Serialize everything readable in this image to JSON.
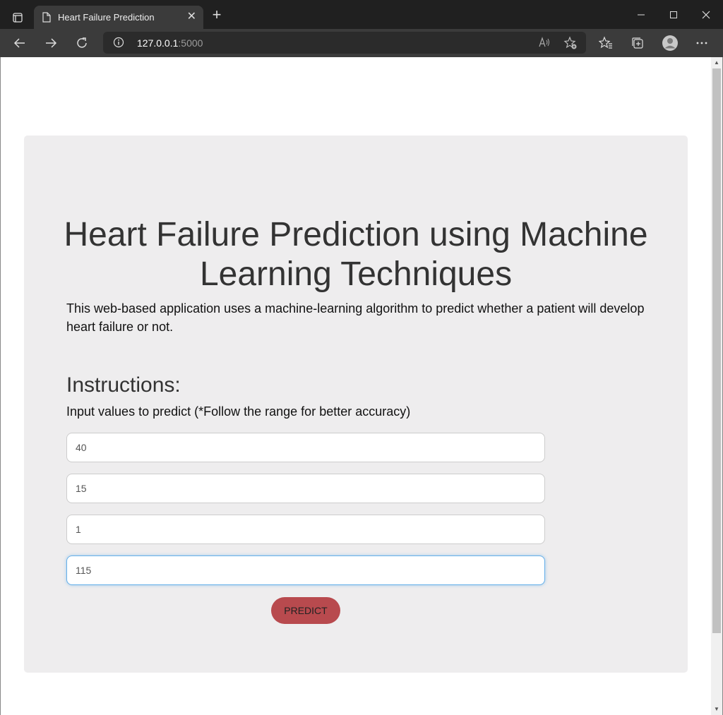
{
  "browser": {
    "tab_title": "Heart Failure Prediction",
    "url_host": "127.0.0.1",
    "url_port": ":5000",
    "new_tab": "+",
    "tab_close": "✕"
  },
  "page": {
    "heading": "Heart Failure Prediction using Machine Learning Techniques",
    "description": "This web-based application uses a machine-learning algorithm to predict whether a patient will develop heart failure or not.",
    "instructions_title": "Instructions:",
    "instructions_text": "Input values to predict (*Follow the range for better accuracy)",
    "inputs": [
      {
        "value": "40"
      },
      {
        "value": "15"
      },
      {
        "value": "1"
      },
      {
        "value": "115"
      }
    ],
    "predict_label": "PREDICT"
  },
  "colors": {
    "button": "#b84a4e",
    "card": "#eeedee",
    "focus_border": "#66afe9"
  }
}
